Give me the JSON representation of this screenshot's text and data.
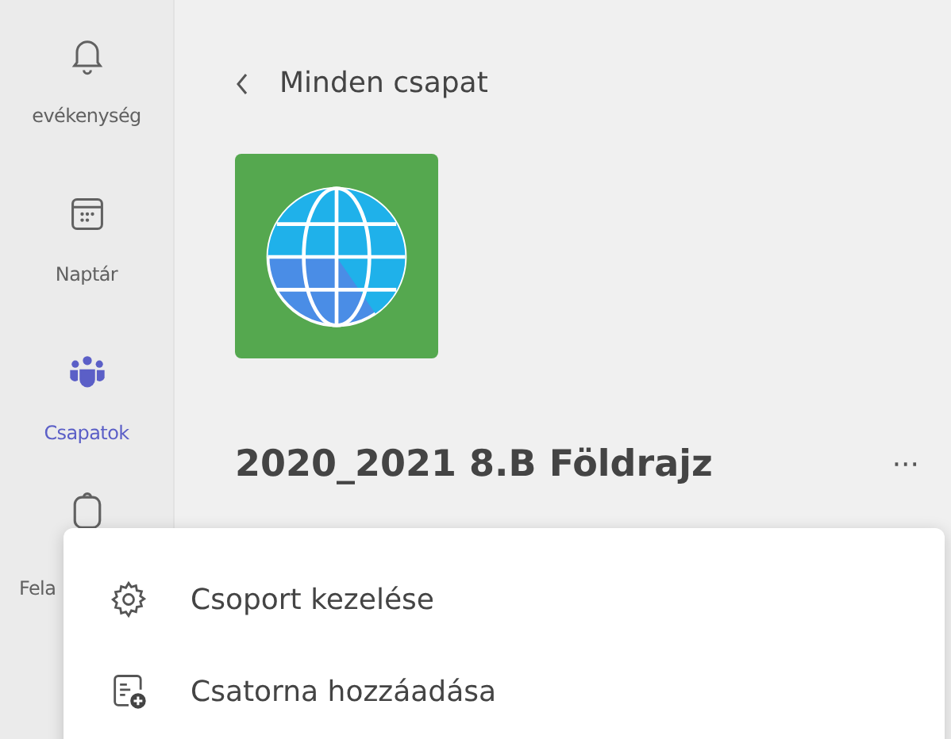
{
  "rail": {
    "items": [
      {
        "kind": "bell",
        "label": "evékenység",
        "selected": false
      },
      {
        "kind": "calendar",
        "label": "Naptár",
        "selected": false
      },
      {
        "kind": "teams",
        "label": "Csapatok",
        "selected": true
      },
      {
        "kind": "assignments",
        "label": "Fela",
        "selected": false
      }
    ]
  },
  "header": {
    "back_label": "Minden csapat"
  },
  "team": {
    "name": "2020_2021 8.B Földrajz",
    "more": "···"
  },
  "menu": {
    "items": [
      {
        "kind": "settings",
        "label": "Csoport kezelése"
      },
      {
        "kind": "add-channel",
        "label": "Csatorna hozzáadása"
      }
    ]
  }
}
